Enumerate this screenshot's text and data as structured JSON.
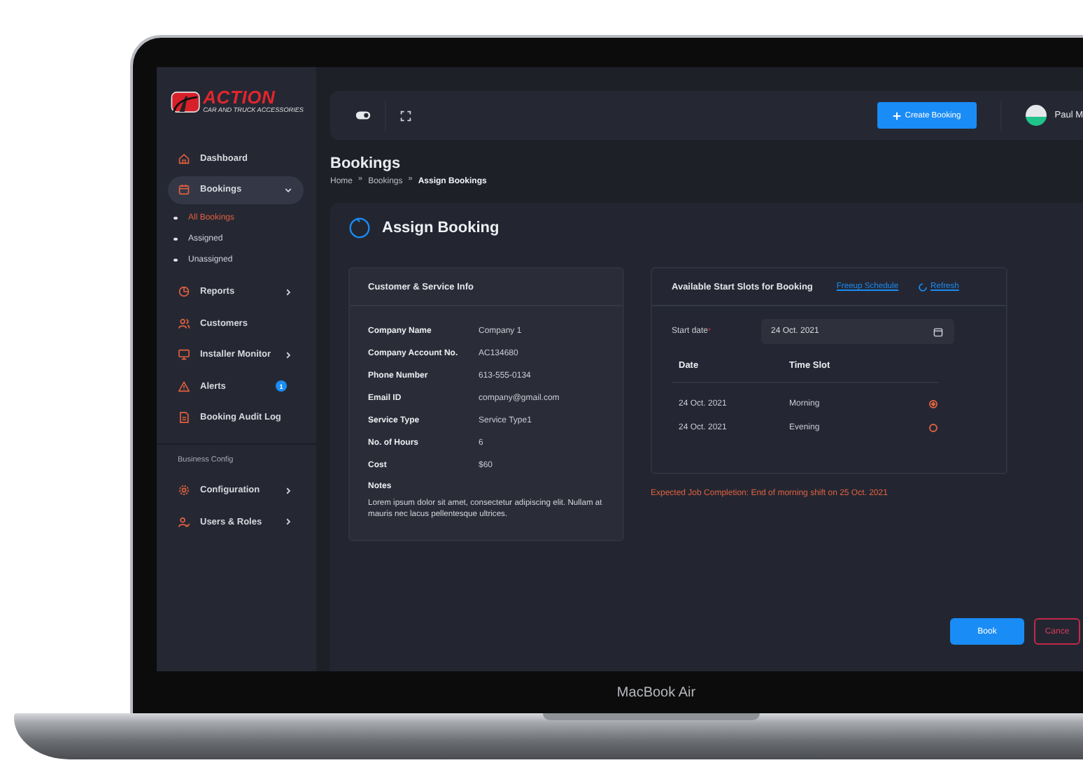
{
  "device": {
    "label": "MacBook Air"
  },
  "brand": {
    "name": "ACTION",
    "tagline": "CAR AND TRUCK ACCESSORIES"
  },
  "sidebar": {
    "sections": [
      {
        "items": [
          {
            "label": "Dashboard",
            "selected": false
          },
          {
            "label": "Bookings",
            "selected": true,
            "expandable": true,
            "expanded": true,
            "children": [
              {
                "label": "All Bookings",
                "selected": true
              },
              {
                "label": "Assigned",
                "selected": false
              },
              {
                "label": "Unassigned",
                "selected": false
              }
            ]
          },
          {
            "label": "Reports",
            "selected": false,
            "expandable": true,
            "expanded": false
          },
          {
            "label": "Customers",
            "selected": false
          },
          {
            "label": "Installer Monitor",
            "selected": false,
            "expandable": true,
            "expanded": false
          },
          {
            "label": "Alerts",
            "selected": false,
            "badge": "1"
          },
          {
            "label": "Booking Audit Log",
            "selected": false
          }
        ]
      },
      {
        "heading": "Business Config",
        "items": [
          {
            "label": "Configuration",
            "selected": false,
            "expandable": true,
            "expanded": false
          },
          {
            "label": "Users & Roles",
            "selected": false,
            "expandable": true,
            "expanded": false
          }
        ]
      }
    ]
  },
  "topbar": {
    "create_button": "Create Booking",
    "user_name": "Paul M"
  },
  "page": {
    "title": "Bookings",
    "breadcrumb": [
      {
        "label": "Home",
        "current": false
      },
      {
        "label": "Bookings",
        "current": false
      },
      {
        "label": "Assign Bookings",
        "current": true
      }
    ],
    "separators": [
      "»",
      "»"
    ]
  },
  "card": {
    "title": "Assign Booking"
  },
  "customer": {
    "title": "Customer & Service Info",
    "fields": [
      {
        "label": "Company Name",
        "value": "Company 1"
      },
      {
        "label": "Company Account No.",
        "value": "AC134680"
      },
      {
        "label": "Phone Number",
        "value": "613-555-0134"
      },
      {
        "label": "Email ID",
        "value": "company@gmail.com"
      },
      {
        "label": "Service Type",
        "value": "Service Type1"
      },
      {
        "label": "No. of Hours",
        "value": "6"
      },
      {
        "label": "Cost",
        "value": "$60"
      }
    ],
    "notes_label": "Notes",
    "notes": "Lorem ipsum dolor sit amet, consectetur adipiscing elit. Nullam at mauris nec lacus pellentesque ultrices."
  },
  "slots": {
    "title": "Available Start Slots for Booking",
    "freeup_link": "Freeup Schedule",
    "refresh_link": "Refresh",
    "start_date": {
      "label": "Start date",
      "required_mark": "*",
      "value": "24 Oct. 2021"
    },
    "columns": [
      "Date",
      "Time Slot"
    ],
    "rows": [
      {
        "date": "24 Oct. 2021",
        "slot": "Morning",
        "selected": true
      },
      {
        "date": "24 Oct. 2021",
        "slot": "Evening",
        "selected": false
      }
    ]
  },
  "expected": "Expected Job Completion: End of morning shift on 25 Oct. 2021",
  "buttons": [
    {
      "label": "Book",
      "kind": "primary"
    },
    {
      "label": "Cance",
      "kind": "outline"
    }
  ]
}
